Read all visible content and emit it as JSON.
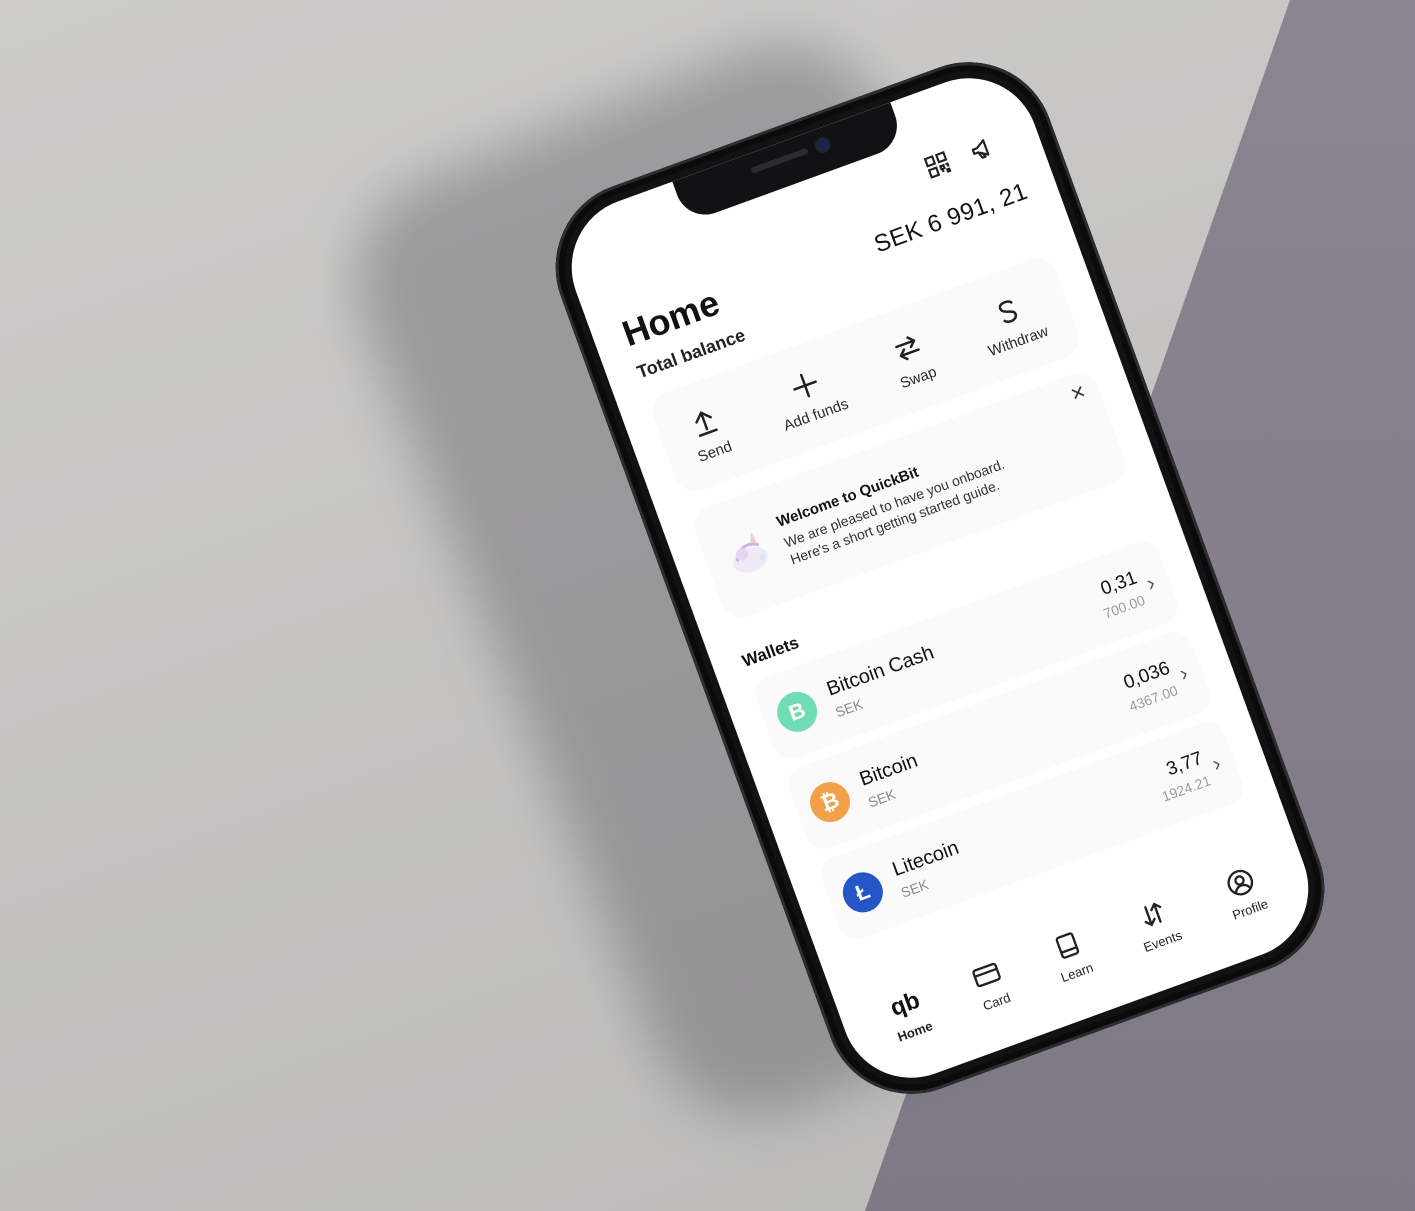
{
  "header": {
    "title": "Home",
    "subtitle": "Total balance",
    "balance": "SEK 6 991, 21"
  },
  "top_icons": [
    "qr-code-icon",
    "megaphone-icon"
  ],
  "actions": [
    {
      "icon": "arrow-up-icon",
      "label": "Send"
    },
    {
      "icon": "plus-icon",
      "label": "Add funds"
    },
    {
      "icon": "swap-arrows-icon",
      "label": "Swap"
    },
    {
      "icon": "dollar-icon",
      "label": "Withdraw"
    }
  ],
  "welcome": {
    "title": "Welcome to QuickBit",
    "line1": "We are pleased to have you onboard.",
    "line2": "Here's a short getting started guide.",
    "close": "×"
  },
  "wallets": {
    "title": "Wallets",
    "items": [
      {
        "name": "Bitcoin Cash",
        "currency": "SEK",
        "amount": "0,31",
        "fiat": "700.00",
        "color": "#6fdcb3",
        "symbol": "B"
      },
      {
        "name": "Bitcoin",
        "currency": "SEK",
        "amount": "0,036",
        "fiat": "4367.00",
        "color": "#f2a04a",
        "symbol": "₿"
      },
      {
        "name": "Litecoin",
        "currency": "SEK",
        "amount": "3,77",
        "fiat": "1924.21",
        "color": "#2456c8",
        "symbol": "Ł"
      }
    ],
    "chevron": "›"
  },
  "tabbar": {
    "home_logo": "qb",
    "tabs": [
      {
        "label": "Home",
        "active": true
      },
      {
        "label": "Card",
        "active": false
      },
      {
        "label": "Learn",
        "active": false
      },
      {
        "label": "Events",
        "active": false
      },
      {
        "label": "Profile",
        "active": false
      }
    ]
  }
}
